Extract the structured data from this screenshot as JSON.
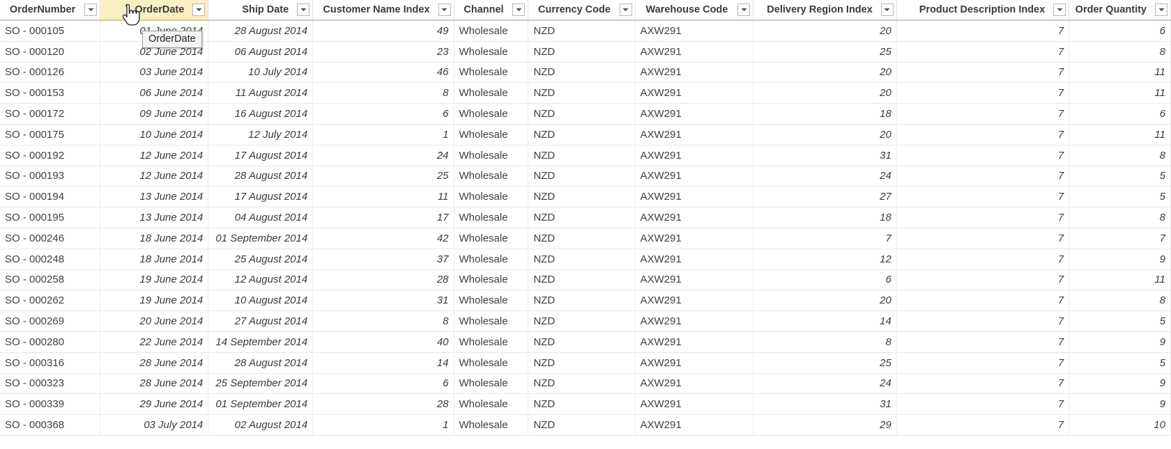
{
  "grid": {
    "columns": [
      {
        "label": "OrderNumber",
        "align": "left",
        "selected": false,
        "filter_icon": "chevron-down-icon"
      },
      {
        "label": "OrderDate",
        "align": "right",
        "selected": true,
        "filter_icon": "chevron-down-icon"
      },
      {
        "label": "Ship Date",
        "align": "right",
        "selected": false,
        "filter_icon": "chevron-down-icon"
      },
      {
        "label": "Customer Name Index",
        "align": "right",
        "selected": false,
        "filter_icon": "chevron-down-icon"
      },
      {
        "label": "Channel",
        "align": "left",
        "selected": false,
        "filter_icon": "chevron-down-icon"
      },
      {
        "label": "Currency Code",
        "align": "left",
        "selected": false,
        "filter_icon": "chevron-down-icon"
      },
      {
        "label": "Warehouse Code",
        "align": "left",
        "selected": false,
        "filter_icon": "chevron-down-icon"
      },
      {
        "label": "Delivery Region Index",
        "align": "right",
        "selected": false,
        "filter_icon": "chevron-down-icon"
      },
      {
        "label": "Product Description Index",
        "align": "right",
        "selected": false,
        "filter_icon": "chevron-down-icon"
      },
      {
        "label": "Order Quantity",
        "align": "right",
        "selected": false,
        "filter_icon": "chevron-down-icon"
      }
    ],
    "rows": [
      [
        "SO - 000105",
        "01 June 2014",
        "28 August 2014",
        "49",
        "Wholesale",
        "NZD",
        "AXW291",
        "20",
        "7",
        "6"
      ],
      [
        "SO - 000120",
        "02 June 2014",
        "06 August 2014",
        "23",
        "Wholesale",
        "NZD",
        "AXW291",
        "25",
        "7",
        "8"
      ],
      [
        "SO - 000126",
        "03 June 2014",
        "10 July 2014",
        "46",
        "Wholesale",
        "NZD",
        "AXW291",
        "20",
        "7",
        "11"
      ],
      [
        "SO - 000153",
        "06 June 2014",
        "11 August 2014",
        "8",
        "Wholesale",
        "NZD",
        "AXW291",
        "20",
        "7",
        "11"
      ],
      [
        "SO - 000172",
        "09 June 2014",
        "16 August 2014",
        "6",
        "Wholesale",
        "NZD",
        "AXW291",
        "18",
        "7",
        "6"
      ],
      [
        "SO - 000175",
        "10 June 2014",
        "12 July 2014",
        "1",
        "Wholesale",
        "NZD",
        "AXW291",
        "20",
        "7",
        "11"
      ],
      [
        "SO - 000192",
        "12 June 2014",
        "17 August 2014",
        "24",
        "Wholesale",
        "NZD",
        "AXW291",
        "31",
        "7",
        "8"
      ],
      [
        "SO - 000193",
        "12 June 2014",
        "28 August 2014",
        "25",
        "Wholesale",
        "NZD",
        "AXW291",
        "24",
        "7",
        "5"
      ],
      [
        "SO - 000194",
        "13 June 2014",
        "17 August 2014",
        "11",
        "Wholesale",
        "NZD",
        "AXW291",
        "27",
        "7",
        "5"
      ],
      [
        "SO - 000195",
        "13 June 2014",
        "04 August 2014",
        "17",
        "Wholesale",
        "NZD",
        "AXW291",
        "18",
        "7",
        "8"
      ],
      [
        "SO - 000246",
        "18 June 2014",
        "01 September 2014",
        "42",
        "Wholesale",
        "NZD",
        "AXW291",
        "7",
        "7",
        "7"
      ],
      [
        "SO - 000248",
        "18 June 2014",
        "25 August 2014",
        "37",
        "Wholesale",
        "NZD",
        "AXW291",
        "12",
        "7",
        "9"
      ],
      [
        "SO - 000258",
        "19 June 2014",
        "12 August 2014",
        "28",
        "Wholesale",
        "NZD",
        "AXW291",
        "6",
        "7",
        "11"
      ],
      [
        "SO - 000262",
        "19 June 2014",
        "10 August 2014",
        "31",
        "Wholesale",
        "NZD",
        "AXW291",
        "20",
        "7",
        "8"
      ],
      [
        "SO - 000269",
        "20 June 2014",
        "27 August 2014",
        "8",
        "Wholesale",
        "NZD",
        "AXW291",
        "14",
        "7",
        "5"
      ],
      [
        "SO - 000280",
        "22 June 2014",
        "14 September 2014",
        "40",
        "Wholesale",
        "NZD",
        "AXW291",
        "8",
        "7",
        "9"
      ],
      [
        "SO - 000316",
        "28 June 2014",
        "28 August 2014",
        "14",
        "Wholesale",
        "NZD",
        "AXW291",
        "25",
        "7",
        "5"
      ],
      [
        "SO - 000323",
        "28 June 2014",
        "25 September 2014",
        "6",
        "Wholesale",
        "NZD",
        "AXW291",
        "24",
        "7",
        "9"
      ],
      [
        "SO - 000339",
        "29 June 2014",
        "01 September 2014",
        "28",
        "Wholesale",
        "NZD",
        "AXW291",
        "31",
        "7",
        "9"
      ],
      [
        "SO - 000368",
        "03 July 2014",
        "02 August 2014",
        "1",
        "Wholesale",
        "NZD",
        "AXW291",
        "29",
        "7",
        "10"
      ]
    ]
  },
  "tooltip": {
    "text": "OrderDate"
  },
  "colors": {
    "selected_header_bg": "#faeec4",
    "header_text": "#3b3b3b",
    "cell_text": "#3f3f3f",
    "grid_line": "#e8e8e8"
  }
}
